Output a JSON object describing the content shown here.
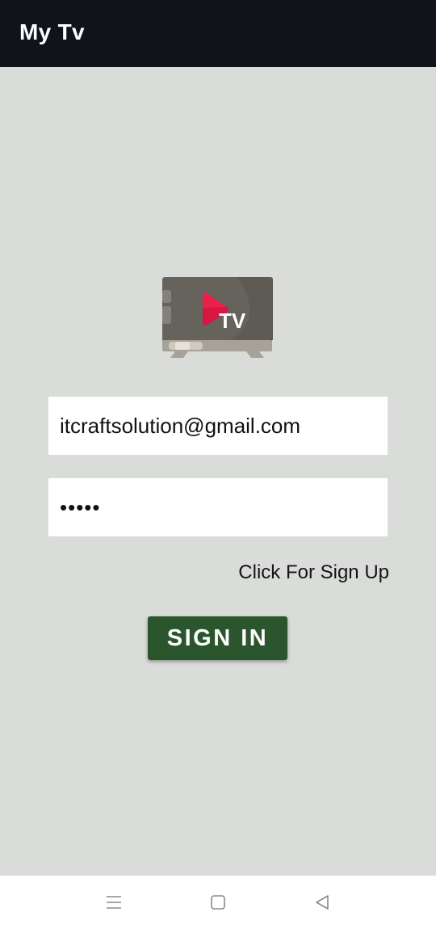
{
  "app_bar": {
    "title": "My Tv"
  },
  "logo": {
    "text": "TV",
    "icon": "tv-logo-icon",
    "colors": {
      "screen": "#66635d",
      "play": "#e8204a",
      "stand": "#a7a297"
    }
  },
  "login_form": {
    "email_value": "itcraftsolution@gmail.com",
    "password_value": "•••••",
    "signup_link": "Click For Sign Up",
    "signin_button": "SIGN IN"
  },
  "colors": {
    "app_bar_bg": "#11131a",
    "page_bg": "#d9dcd9",
    "button_bg": "#2b552d"
  },
  "nav_bar": {
    "icons": [
      "menu-icon",
      "home-square-icon",
      "back-triangle-icon"
    ]
  }
}
